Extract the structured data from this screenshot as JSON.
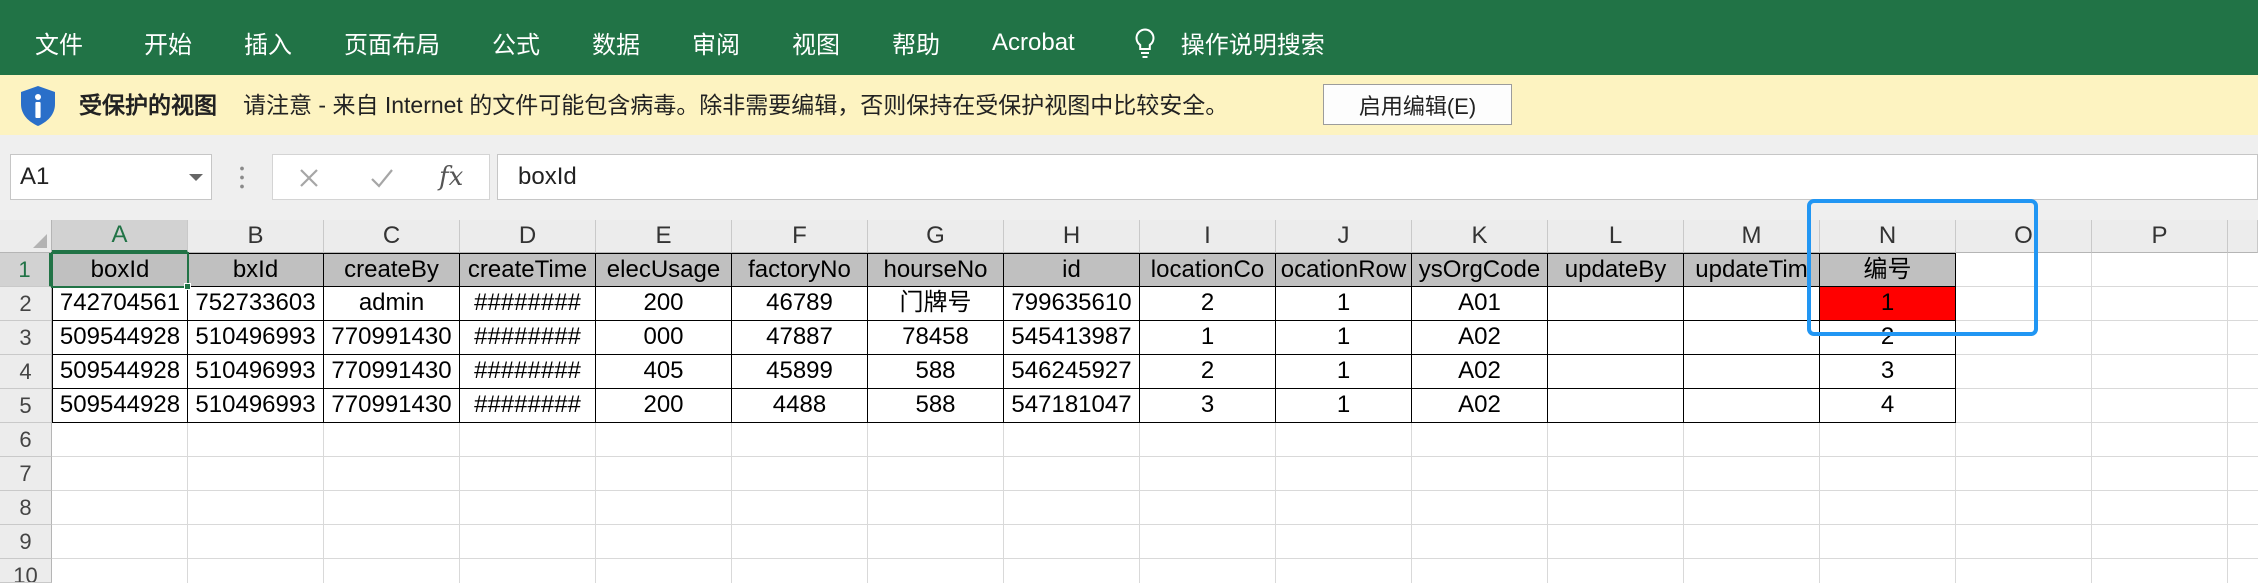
{
  "ribbon": {
    "background": "#217346",
    "tabs": [
      "文件",
      "开始",
      "插入",
      "页面布局",
      "公式",
      "数据",
      "审阅",
      "视图",
      "帮助",
      "Acrobat"
    ],
    "search_icon": "lightbulb-icon",
    "search_label": "操作说明搜索"
  },
  "protected_view": {
    "background": "#fdf3c1",
    "icon": "shield-info-icon",
    "title": "受保护的视图",
    "message": "请注意 - 来自 Internet 的文件可能包含病毒。除非需要编辑，否则保持在受保护视图中比较安全。",
    "enable_button": "启用编辑(E)"
  },
  "formula_bar": {
    "name_box": "A1",
    "name_box_icon": "chevron-down-icon",
    "cancel_icon": "close-icon",
    "enter_icon": "check-icon",
    "function_label": "fx",
    "content": "boxId"
  },
  "sheet": {
    "columns": [
      "A",
      "B",
      "C",
      "D",
      "E",
      "F",
      "G",
      "H",
      "I",
      "J",
      "K",
      "L",
      "M",
      "N",
      "O",
      "P"
    ],
    "row_numbers": [
      "1",
      "2",
      "3",
      "4",
      "5",
      "6",
      "7",
      "8",
      "9",
      "10"
    ],
    "header_fill": "#c0c0c0",
    "cells": [
      [
        "boxId",
        "bxId",
        "createBy",
        "createTime",
        "elecUsage",
        "factoryNo",
        "hourseNo",
        "id",
        "locationCo",
        "ocationRow",
        "ysOrgCode",
        "updateBy",
        "updateTim",
        "编号"
      ],
      [
        "742704561",
        "752733603",
        "admin",
        "########",
        "200",
        "46789",
        "门牌号",
        "799635610",
        "2",
        "1",
        "A01",
        "",
        "",
        "1"
      ],
      [
        "509544928",
        "510496993",
        "770991430",
        "########",
        "000",
        "47887",
        "78458",
        "545413987",
        "1",
        "1",
        "A02",
        "",
        "",
        "2"
      ],
      [
        "509544928",
        "510496993",
        "770991430",
        "########",
        "405",
        "45899",
        "588",
        "546245927",
        "2",
        "1",
        "A02",
        "",
        "",
        "3"
      ],
      [
        "509544928",
        "510496993",
        "770991430",
        "########",
        "200",
        "4488",
        "588",
        "547181047",
        "3",
        "1",
        "A02",
        "",
        "",
        "4"
      ]
    ],
    "cell_fills": [
      {
        "row": 2,
        "col": 14,
        "color": "#ff0000"
      }
    ]
  },
  "annotation": {
    "color": "#2196f3"
  }
}
